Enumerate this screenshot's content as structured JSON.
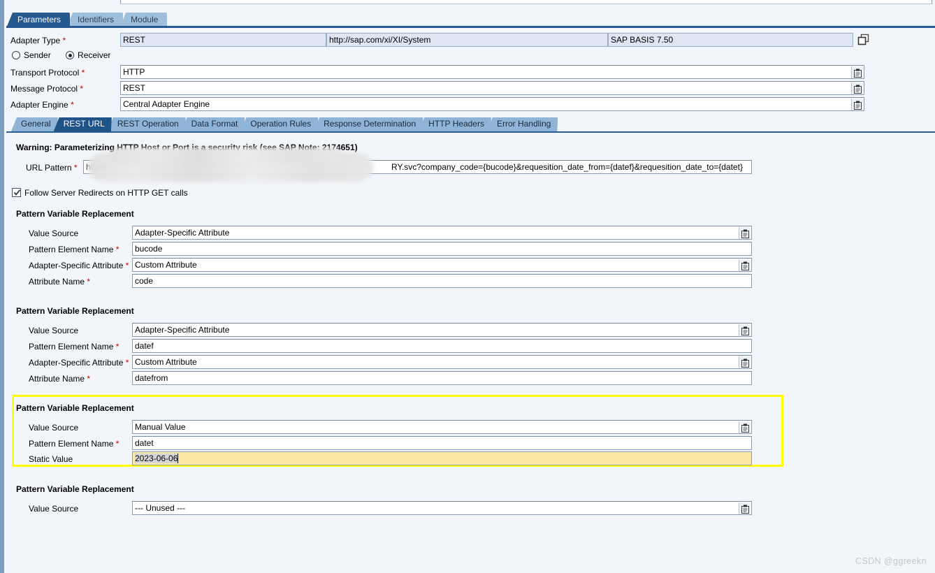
{
  "window": {
    "main_tabs": [
      {
        "label": "Parameters",
        "selected": true
      },
      {
        "label": "Identifiers",
        "selected": false
      },
      {
        "label": "Module",
        "selected": false
      }
    ]
  },
  "header": {
    "adapter_type_label": "Adapter Type",
    "adapter_type_value": "REST",
    "namespace_value": "http://sap.com/xi/XI/System",
    "software_component_value": "SAP BASIS 7.50",
    "copy_icon": "copy-icon",
    "direction": {
      "sender_label": "Sender",
      "receiver_label": "Receiver",
      "selected": "Receiver"
    },
    "transport_protocol_label": "Transport Protocol",
    "transport_protocol_value": "HTTP",
    "message_protocol_label": "Message Protocol",
    "message_protocol_value": "REST",
    "adapter_engine_label": "Adapter Engine",
    "adapter_engine_value": "Central Adapter Engine"
  },
  "sub_tabs": [
    {
      "label": "General",
      "selected": false
    },
    {
      "label": "REST URL",
      "selected": true
    },
    {
      "label": "REST Operation",
      "selected": false
    },
    {
      "label": "Data Format",
      "selected": false
    },
    {
      "label": "Operation Rules",
      "selected": false
    },
    {
      "label": "Response Determination",
      "selected": false
    },
    {
      "label": "HTTP Headers",
      "selected": false
    },
    {
      "label": "Error Handling",
      "selected": false
    }
  ],
  "rest_url": {
    "warning": "Warning: Parameterizing HTTP Host or Port is a security risk (see SAP Note: 2174651)",
    "url_pattern_label": "URL Pattern",
    "url_pattern_prefix": "http://",
    "url_pattern_suffix": "RY.svc?company_code={bucode}&requesition_date_from={datef}&requesition_date_to={datet}",
    "follow_redirects_label": "Follow Server Redirects on HTTP GET calls",
    "follow_redirects_checked": true
  },
  "pattern_blocks": [
    {
      "title": "Pattern Variable Replacement",
      "highlighted": false,
      "value_source_label": "Value Source",
      "value_source_value": "Adapter-Specific Attribute",
      "pattern_element_label": "Pattern Element Name",
      "pattern_element_value": "bucode",
      "adapter_attr_label": "Adapter-Specific Attribute",
      "adapter_attr_value": "Custom Attribute",
      "attribute_name_label": "Attribute Name",
      "attribute_name_value": "code"
    },
    {
      "title": "Pattern Variable Replacement",
      "highlighted": false,
      "value_source_label": "Value Source",
      "value_source_value": "Adapter-Specific Attribute",
      "pattern_element_label": "Pattern Element Name",
      "pattern_element_value": "datef",
      "adapter_attr_label": "Adapter-Specific Attribute",
      "adapter_attr_value": "Custom Attribute",
      "attribute_name_label": "Attribute Name",
      "attribute_name_value": "datefrom"
    },
    {
      "title": "Pattern Variable Replacement",
      "highlighted": true,
      "value_source_label": "Value Source",
      "value_source_value": "Manual Value",
      "pattern_element_label": "Pattern Element Name",
      "pattern_element_value": "datet",
      "static_value_label": "Static Value",
      "static_value_value": "2023-06-06"
    },
    {
      "title": "Pattern Variable Replacement",
      "highlighted": false,
      "value_source_label": "Value Source",
      "value_source_value": "--- Unused ---"
    }
  ],
  "watermark": "CSDN @ggreekn",
  "colors": {
    "tab_selected": "#26598f",
    "tab_normal": "#9fc0dd",
    "readonly_field": "#dde6f2",
    "highlight_border": "#ffff00",
    "focused_field": "#fde9a6",
    "required_star": "#c00000"
  }
}
